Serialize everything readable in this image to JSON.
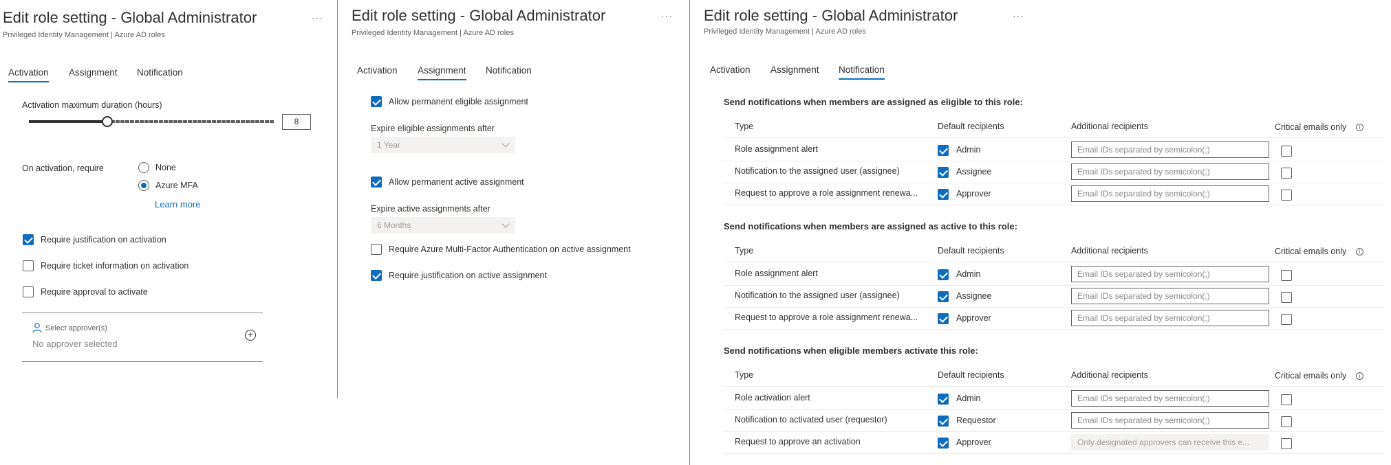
{
  "panel1": {
    "title": "Edit role setting - Global Administrator",
    "subtitle": "Privileged Identity Management | Azure AD roles",
    "ellipsis": "···",
    "tabs": [
      "Activation",
      "Assignment",
      "Notification"
    ],
    "active_tab": "Activation",
    "duration_label": "Activation maximum duration (hours)",
    "duration_value": "8",
    "duration_fraction": 0.32,
    "require_label": "On activation, require",
    "radio_options": [
      "None",
      "Azure MFA"
    ],
    "radio_selected": "Azure MFA",
    "learn_more": "Learn more",
    "checkboxes": [
      {
        "label": "Require justification on activation",
        "checked": true
      },
      {
        "label": "Require ticket information on activation",
        "checked": false
      },
      {
        "label": "Require approval to activate",
        "checked": false
      }
    ],
    "approver_label": "Select approver(s)",
    "approver_value": "No approver selected",
    "icons": {
      "person": "person-icon",
      "add": "add-circle-icon"
    }
  },
  "panel2": {
    "title": "Edit role setting - Global Administrator",
    "subtitle": "Privileged Identity Management | Azure AD roles",
    "ellipsis": "···",
    "tabs": [
      "Activation",
      "Assignment",
      "Notification"
    ],
    "active_tab": "Assignment",
    "allow_eligible": {
      "label": "Allow permanent eligible assignment",
      "checked": true
    },
    "expire_eligible_label": "Expire eligible assignments after",
    "expire_eligible_value": "1 Year",
    "allow_active": {
      "label": "Allow permanent active assignment",
      "checked": true
    },
    "expire_active_label": "Expire active assignments after",
    "expire_active_value": "6 Months",
    "require_mfa": {
      "label": "Require Azure Multi-Factor Authentication on active assignment",
      "checked": false
    },
    "require_justification": {
      "label": "Require justification on active assignment",
      "checked": true
    }
  },
  "panel3": {
    "title": "Edit role setting - Global Administrator",
    "subtitle": "Privileged Identity Management | Azure AD roles",
    "ellipsis": "···",
    "tabs": [
      "Activation",
      "Assignment",
      "Notification"
    ],
    "active_tab": "Notification",
    "columns": [
      "Type",
      "Default recipients",
      "Additional recipients",
      "Critical emails only"
    ],
    "sections": [
      {
        "heading": "Send notifications when members are assigned as eligible to this role:",
        "rows": [
          {
            "type": "Role assignment alert",
            "recipient": "Admin",
            "default_checked": true,
            "email_placeholder": "Email IDs separated by semicolon(;)",
            "email_disabled": false,
            "critical": false
          },
          {
            "type": "Notification to the assigned user (assignee)",
            "recipient": "Assignee",
            "default_checked": true,
            "email_placeholder": "Email IDs separated by semicolon(;)",
            "email_disabled": false,
            "critical": false
          },
          {
            "type": "Request to approve a role assignment renewa...",
            "recipient": "Approver",
            "default_checked": true,
            "email_placeholder": "Email IDs separated by semicolon(;)",
            "email_disabled": false,
            "critical": false
          }
        ]
      },
      {
        "heading": "Send notifications when members are assigned as active to this role:",
        "rows": [
          {
            "type": "Role assignment alert",
            "recipient": "Admin",
            "default_checked": true,
            "email_placeholder": "Email IDs separated by semicolon(;)",
            "email_disabled": false,
            "critical": false
          },
          {
            "type": "Notification to the assigned user (assignee)",
            "recipient": "Assignee",
            "default_checked": true,
            "email_placeholder": "Email IDs separated by semicolon(;)",
            "email_disabled": false,
            "critical": false
          },
          {
            "type": "Request to approve a role assignment renewa...",
            "recipient": "Approver",
            "default_checked": true,
            "email_placeholder": "Email IDs separated by semicolon(;)",
            "email_disabled": false,
            "critical": false
          }
        ]
      },
      {
        "heading": "Send notifications when eligible members activate this role:",
        "rows": [
          {
            "type": "Role activation alert",
            "recipient": "Admin",
            "default_checked": true,
            "email_placeholder": "Email IDs separated by semicolon(;)",
            "email_disabled": false,
            "critical": false
          },
          {
            "type": "Notification to activated user (requestor)",
            "recipient": "Requestor",
            "default_checked": true,
            "email_placeholder": "Email IDs separated by semicolon(;)",
            "email_disabled": false,
            "critical": false
          },
          {
            "type": "Request to approve an activation",
            "recipient": "Approver",
            "default_checked": true,
            "email_placeholder": "Only designated approvers can receive this e...",
            "email_disabled": true,
            "critical": false
          }
        ]
      }
    ],
    "info_glyph": "i"
  },
  "colors": {
    "accent": "#0f6cbd",
    "text": "#323130",
    "muted": "#605e5c",
    "divider": "#8a8886"
  }
}
